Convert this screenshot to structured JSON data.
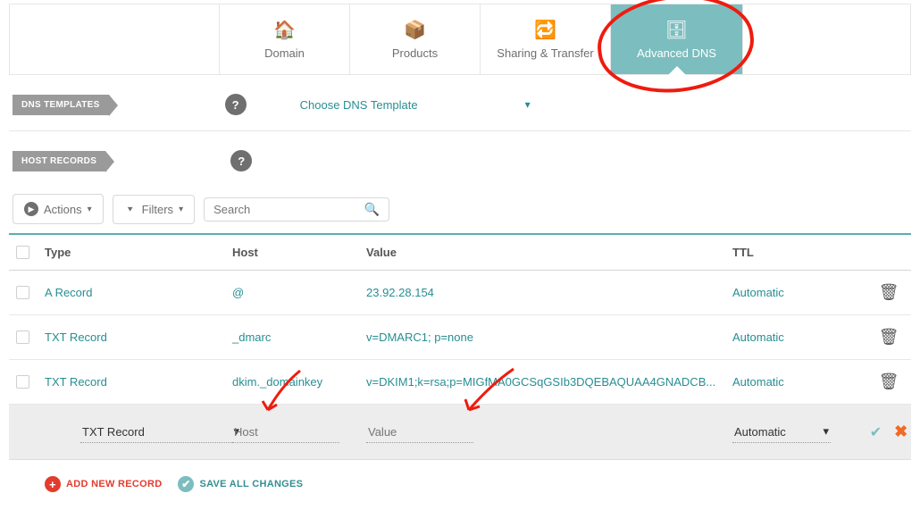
{
  "tabs": [
    {
      "label": "Domain",
      "icon": "home-icon",
      "glyph": "🏠"
    },
    {
      "label": "Products",
      "icon": "box-icon",
      "glyph": "📦"
    },
    {
      "label": "Sharing & Transfer",
      "icon": "share-icon",
      "glyph": "🔁"
    },
    {
      "label": "Advanced DNS",
      "icon": "dns-icon",
      "glyph": "🗄",
      "active": true
    }
  ],
  "sections": {
    "dns_templates_label": "DNS TEMPLATES",
    "host_records_label": "HOST RECORDS",
    "choose_template_label": "Choose DNS Template"
  },
  "toolbar": {
    "actions_label": "Actions",
    "filters_label": "Filters",
    "search_placeholder": "Search"
  },
  "table": {
    "headers": {
      "type": "Type",
      "host": "Host",
      "value": "Value",
      "ttl": "TTL"
    },
    "rows": [
      {
        "type": "A Record",
        "host": "@",
        "value": "23.92.28.154",
        "ttl": "Automatic"
      },
      {
        "type": "TXT Record",
        "host": "_dmarc",
        "value": "v=DMARC1; p=none",
        "ttl": "Automatic"
      },
      {
        "type": "TXT Record",
        "host": "dkim._domainkey",
        "value": "v=DKIM1;k=rsa;p=MIGfMA0GCSqGSIb3DQEBAQUAA4GNADCB...",
        "ttl": "Automatic"
      }
    ],
    "edit_row": {
      "type_label": "TXT Record",
      "host_placeholder": "Host",
      "value_placeholder": "Value",
      "ttl_label": "Automatic"
    }
  },
  "footer": {
    "add_label": "ADD NEW RECORD",
    "save_label": "SAVE ALL CHANGES"
  },
  "colors": {
    "accent": "#7cbdbf",
    "link": "#278e93",
    "danger": "#e33b2e",
    "annotation": "#ef1b0e"
  }
}
